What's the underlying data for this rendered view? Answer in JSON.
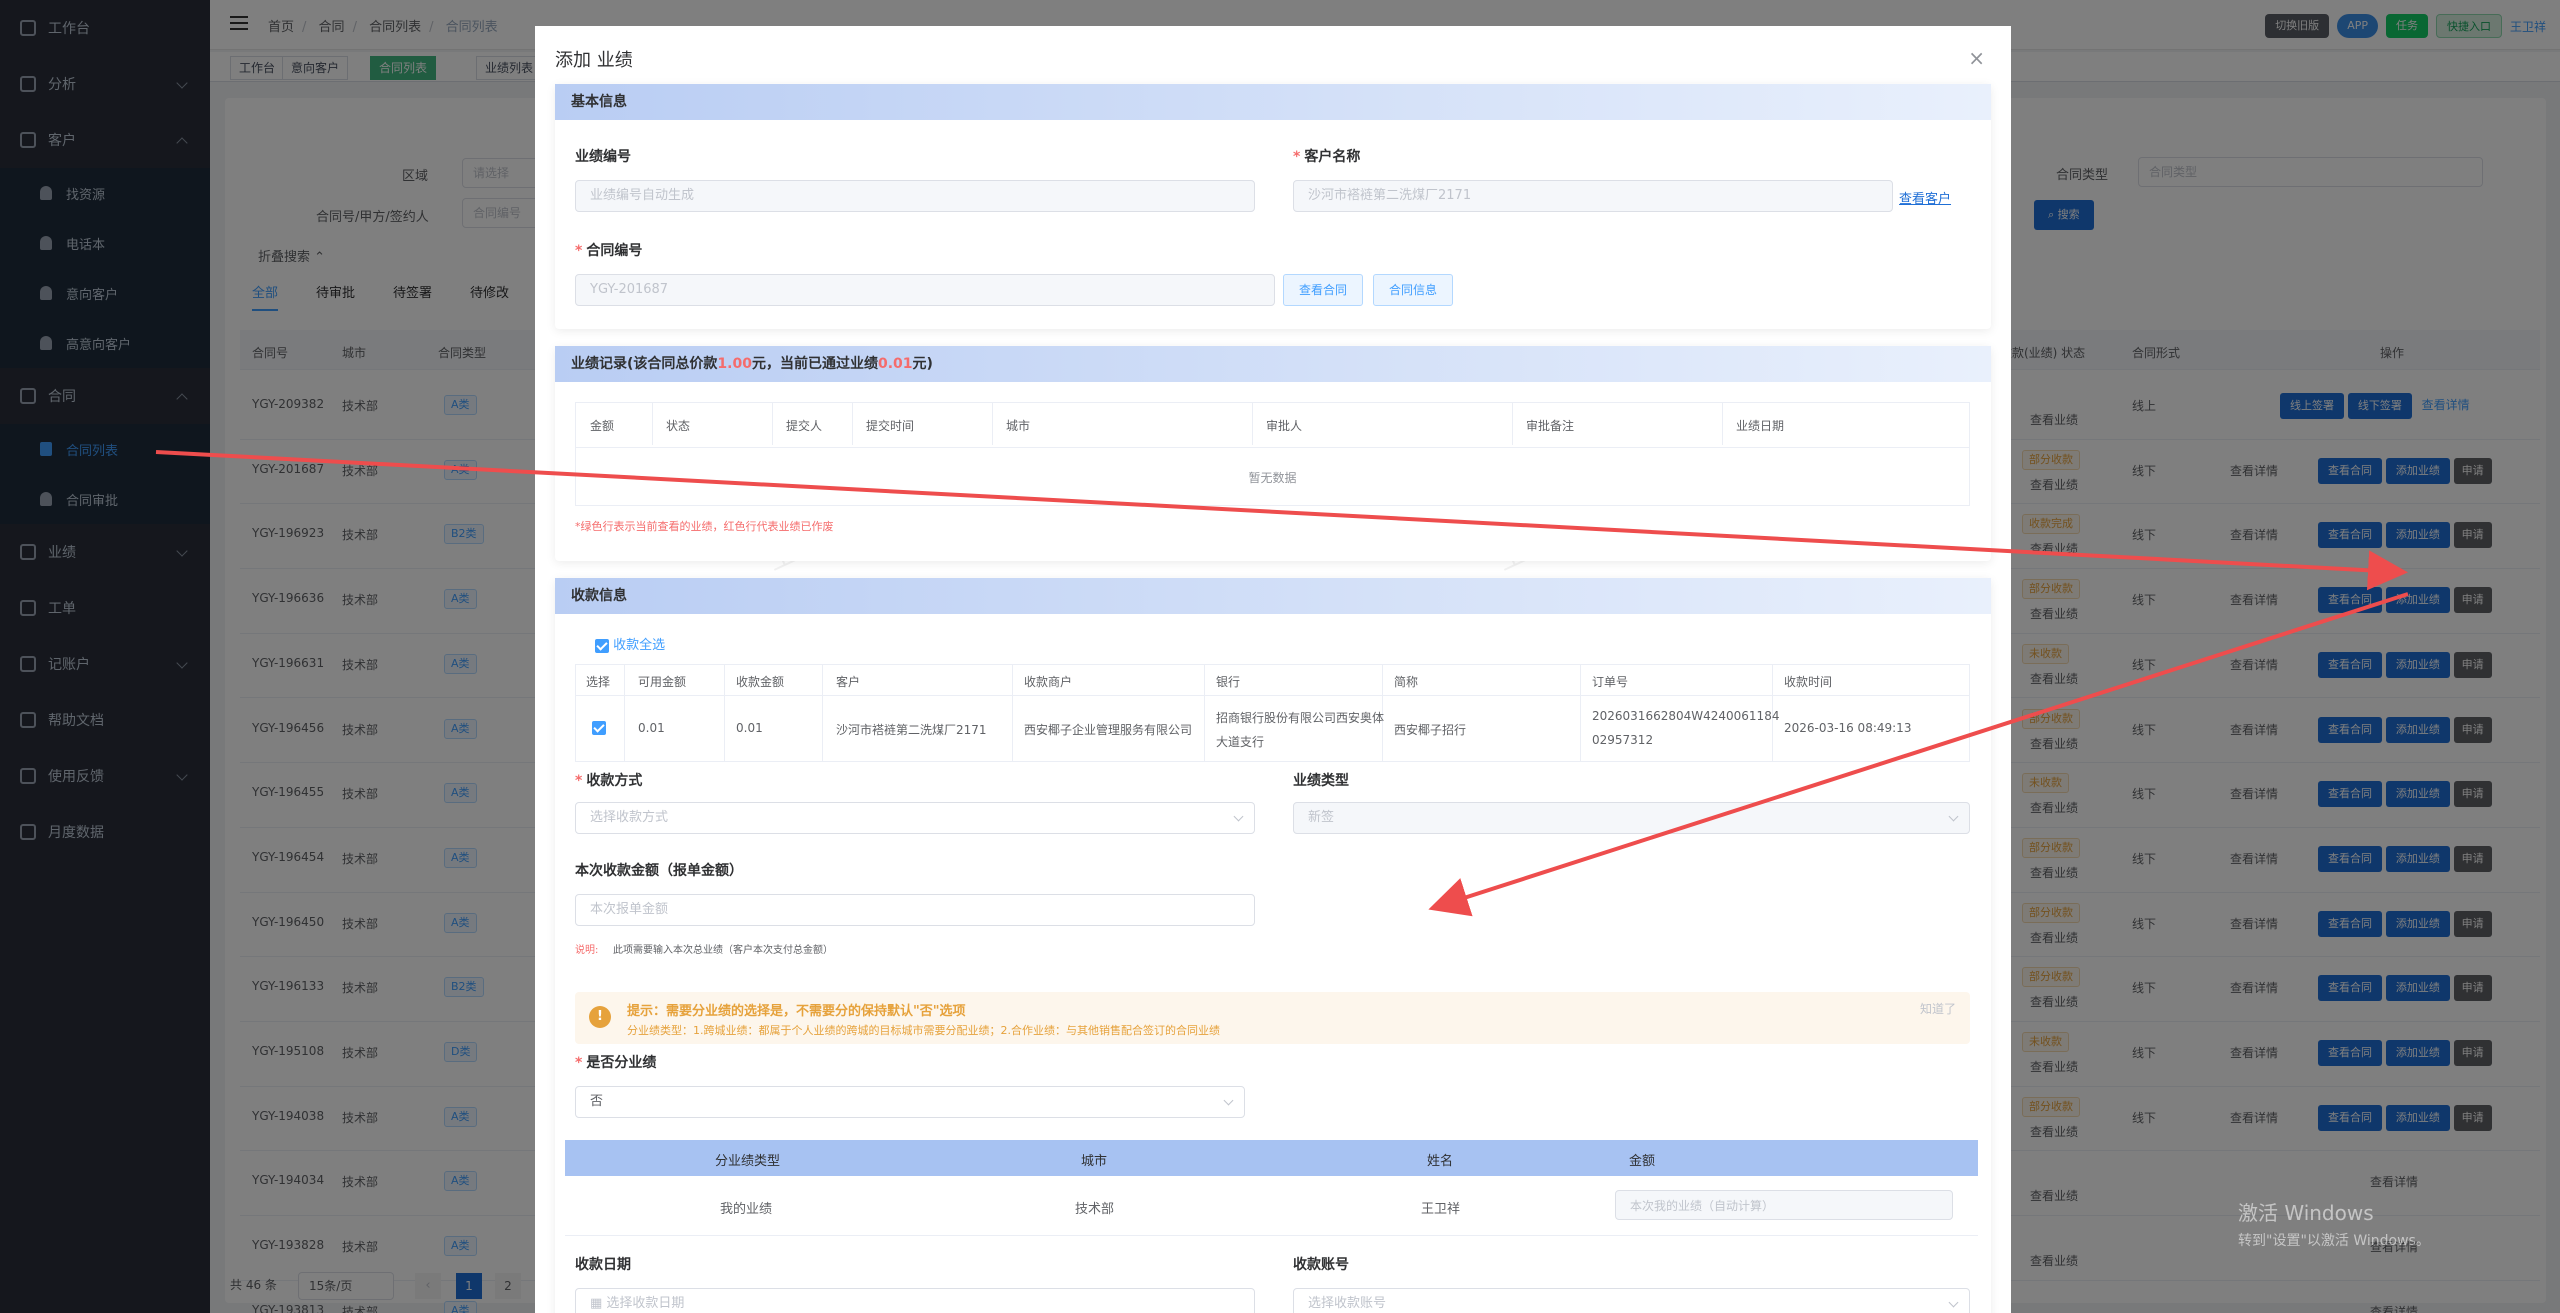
{
  "sidebar": {
    "items": [
      {
        "label": "工作台",
        "icon": "dashboard-icon",
        "arrow": ""
      },
      {
        "label": "分析",
        "icon": "chart-icon",
        "arrow": "down"
      },
      {
        "label": "客户",
        "icon": "user-icon",
        "arrow": "up"
      }
    ],
    "customer_sub": [
      "找资源",
      "电话本",
      "意向客户",
      "高意向客户"
    ],
    "contract_label": "合同",
    "contract_sub": [
      "合同列表",
      "合同审批"
    ],
    "more": [
      {
        "label": "业绩",
        "icon": "performance-icon",
        "arrow": "down"
      },
      {
        "label": "工单",
        "icon": "ticket-icon",
        "arrow": ""
      },
      {
        "label": "记账户",
        "icon": "ledger-icon",
        "arrow": "down"
      },
      {
        "label": "帮助文档",
        "icon": "help-icon",
        "arrow": ""
      },
      {
        "label": "使用反馈",
        "icon": "feedback-icon",
        "arrow": "down"
      },
      {
        "label": "月度数据",
        "icon": "monthly-icon",
        "arrow": ""
      }
    ]
  },
  "header": {
    "breadcrumb": [
      "首页",
      "合同",
      "合同列表",
      "合同列表"
    ],
    "buttons": [
      {
        "label": "切换旧版",
        "color": "#5a5e66"
      },
      {
        "label": "APP",
        "color": "#3a8ee6"
      },
      {
        "label": "任务",
        "color": "#13ce66"
      },
      {
        "label": "快捷入口",
        "color": "#d9f1e1"
      }
    ],
    "user": "王卫祥"
  },
  "tags": [
    "工作台",
    "意向客户",
    "合同列表",
    "业绩列表"
  ],
  "filters": {
    "area_label": "区域",
    "area_placeholder": "请选择",
    "contract_label": "合同号/甲方/签约人",
    "contract_placeholder": "合同编号",
    "type_label": "合同类型",
    "type_placeholder": "合同类型",
    "search": "搜索",
    "collapse": "折叠搜索"
  },
  "tabs": [
    "全部",
    "待审批",
    "待签署",
    "待修改"
  ],
  "bg_table": {
    "headers": [
      "合同号",
      "城市",
      "合同类型",
      "",
      "",
      "收款(业绩) 状态",
      "合同形式",
      "操作"
    ],
    "rows": [
      {
        "id": "YGY-209382",
        "city": "技术部",
        "type": "A类",
        "status": "",
        "form": "线上"
      },
      {
        "id": "YGY-201687",
        "city": "技术部",
        "type": "A类",
        "status": "部分收款",
        "form": "线下"
      },
      {
        "id": "YGY-196923",
        "city": "技术部",
        "type": "B2类",
        "status": "收款完成",
        "form": "线下"
      },
      {
        "id": "YGY-196636",
        "city": "技术部",
        "type": "A类",
        "status": "部分收款",
        "form": "线下"
      },
      {
        "id": "YGY-196631",
        "city": "技术部",
        "type": "A类",
        "status": "未收款",
        "form": "线下"
      },
      {
        "id": "YGY-196456",
        "city": "技术部",
        "type": "A类",
        "status": "部分收款",
        "form": "线下"
      },
      {
        "id": "YGY-196455",
        "city": "技术部",
        "type": "A类",
        "status": "未收款",
        "form": "线下"
      },
      {
        "id": "YGY-196454",
        "city": "技术部",
        "type": "A类",
        "status": "部分收款",
        "form": "线下"
      },
      {
        "id": "YGY-196450",
        "city": "技术部",
        "type": "A类",
        "status": "部分收款",
        "form": "线下"
      },
      {
        "id": "YGY-196133",
        "city": "技术部",
        "type": "B2类",
        "status": "部分收款",
        "form": "线下"
      },
      {
        "id": "YGY-195108",
        "city": "技术部",
        "type": "D类",
        "status": "未收款",
        "form": "线下"
      },
      {
        "id": "YGY-194038",
        "city": "技术部",
        "type": "A类",
        "status": "部分收款",
        "form": "线下"
      },
      {
        "id": "YGY-194034",
        "city": "技术部",
        "type": "A类",
        "status": "",
        "form": ""
      },
      {
        "id": "YGY-193828",
        "city": "技术部",
        "type": "A类",
        "status": "",
        "form": ""
      },
      {
        "id": "YGY-193813",
        "city": "技术部",
        "type": "A类",
        "status": "",
        "form": ""
      }
    ],
    "ops": {
      "view": "查看详情",
      "contract": "查看合同",
      "add": "添加业绩",
      "apply": "申请",
      "online": "线上签署",
      "offline": "线下签署",
      "perf": "查看业绩"
    }
  },
  "pagination": {
    "total": "共 46 条",
    "size": "15条/页",
    "page1": "1",
    "page2": "2"
  },
  "dialog": {
    "title": "添加 业绩",
    "basic": {
      "header": "基本信息",
      "no_label": "业绩编号",
      "no_placeholder": "业绩编号自动生成",
      "cust_label": "客户名称",
      "cust_value": "沙河市褡裢第二洗煤厂2171",
      "view_cust": "查看客户",
      "contract_label": "合同编号",
      "contract_value": "YGY-201687",
      "view_contract": "查看合同",
      "contract_info": "合同信息"
    },
    "record": {
      "h1": "业绩记录(该合同总价款",
      "total": "1.00",
      "h2": "元，当前已通过业绩",
      "passed": "0.01",
      "h3": "元)",
      "headers": [
        "金额",
        "状态",
        "提交人",
        "提交时间",
        "城市",
        "审批人",
        "审批备注",
        "业绩日期"
      ],
      "empty": "暂无数据",
      "note": "*绿色行表示当前查看的业绩，红色行代表业绩已作废"
    },
    "pay": {
      "header": "收款信息",
      "select_all": "收款全选",
      "headers": [
        "选择",
        "可用金额",
        "收款金额",
        "客户",
        "收款商户",
        "银行",
        "简称",
        "订单号",
        "收款时间"
      ],
      "row": {
        "avail": "0.01",
        "amount": "0.01",
        "cust": "沙河市褡裢第二洗煤厂2171",
        "merchant": "西安椰子企业管理服务有限公司",
        "bank1": "招商银行股份有限公司西安奥体",
        "bank2": "大道支行",
        "short": "西安椰子招行",
        "order1": "2026031662804W4240061184",
        "order2": "02957312",
        "time": "2026-03-16 08:49:13"
      },
      "method_label": "收款方式",
      "method_placeholder": "选择收款方式",
      "ptype_label": "业绩类型",
      "ptype_value": "新签",
      "amount_label": "本次收款金额（报单金额）",
      "amount_placeholder": "本次报单金额",
      "explain_key": "说明:",
      "explain": "此项需要输入本次总业绩（客户本次支付总金额）",
      "tip_title": "提示：需要分业绩的选择是，不需要分的保持默认\"否\"选项",
      "tip_body": "分业绩类型：1.跨城业绩：都属于个人业绩的跨城的目标城市需要分配业绩；2.合作业绩：与其他销售配合签订的合同业绩",
      "tip_close": "知道了",
      "split_label": "是否分业绩",
      "split_value": "否",
      "split_headers": [
        "分业绩类型",
        "城市",
        "姓名",
        "金额"
      ],
      "split_row": {
        "type": "我的业绩",
        "city": "技术部",
        "name": "王卫祥",
        "amount_placeholder": "本次我的业绩（自动计算）"
      },
      "date_label": "收款日期",
      "date_placeholder": "选择收款日期",
      "account_label": "收款账号",
      "account_placeholder": "选择收款账号"
    }
  },
  "watermark": "王卫祥",
  "windows": {
    "line1": "激活 Windows",
    "line2": "转到\"设置\"以激活 Windows。"
  },
  "colors": {
    "sidebar": "#2b2f3a",
    "primary": "#409eff",
    "danger": "#f56c6c",
    "arrow": "#ee4d4d"
  }
}
